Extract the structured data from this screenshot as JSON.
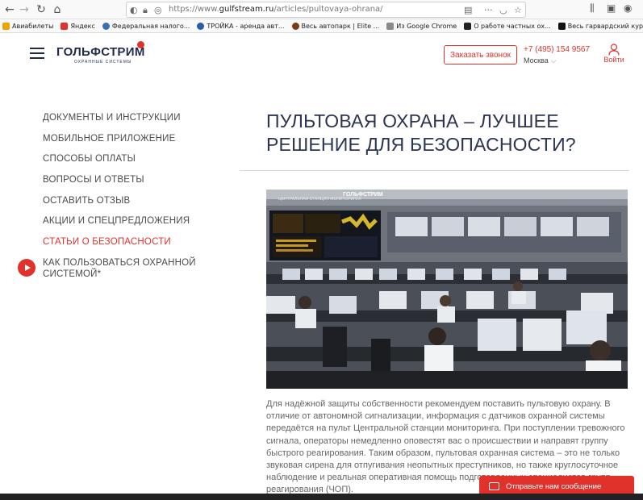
{
  "browser": {
    "url_prefix": "https://www.",
    "url_domain": "gulfstream.ru",
    "url_path": "/articles/pultovaya-ohrana/",
    "bookmarks": [
      {
        "label": "Авиабилеты",
        "color": "#f0a400"
      },
      {
        "label": "Яндекс",
        "color": "#e0322b"
      },
      {
        "label": "Федеральная налого...",
        "color": "#3a6fb0"
      },
      {
        "label": "ТРОЙКА - аренда авт...",
        "color": "#2a5ba8"
      },
      {
        "label": "Весь автопарк | Elite ...",
        "color": "#7a3b12"
      },
      {
        "label": "Из Google Chrome",
        "color": "#8a8a8a"
      },
      {
        "label": "О работе частных ох...",
        "color": "#222222"
      },
      {
        "label": "Весь гарвардский кур...",
        "color": "#111111"
      }
    ]
  },
  "header": {
    "logo_main": "ГОЛЬФСТРИМ",
    "logo_sub": "ОХРАННЫЕ СИСТЕМЫ",
    "callback_label": "Заказать звонок",
    "phone": "+7 (495) 154 9567",
    "city": "Москва",
    "login_label": "Войти"
  },
  "sidebar": {
    "items": [
      {
        "label": "ДОКУМЕНТЫ И ИНСТРУКЦИИ"
      },
      {
        "label": "МОБИЛЬНОЕ ПРИЛОЖЕНИЕ"
      },
      {
        "label": "СПОСОБЫ ОПЛАТЫ"
      },
      {
        "label": "ВОПРОСЫ И ОТВЕТЫ"
      },
      {
        "label": "ОСТАВИТЬ ОТЗЫВ"
      },
      {
        "label": "АКЦИИ И СПЕЦПРЕДЛОЖЕНИЯ"
      },
      {
        "label": "СТАТЬИ О БЕЗОПАСНОСТИ"
      },
      {
        "label": "КАК ПОЛЬЗОВАТЬСЯ ОХРАННОЙ СИСТЕМОЙ*"
      }
    ]
  },
  "article": {
    "title": "ПУЛЬТОВАЯ ОХРАНА – ЛУЧШЕЕ РЕШЕНИЕ ДЛЯ БЕЗОПАСНОСТИ?",
    "photo_sign": "ГОЛЬФСТРИМ",
    "photo_sign_sub": "ЦЕНТРАЛЬНАЯ СТАНЦИЯ МОНИТОРИНГА",
    "body": "Для надёжной защиты собственности рекомендуем поставить пультовую охрану. В отличие от автономной сигнализации, информация с датчиков охранной системы передаётся на пульт Центральной станции мониторинга. При поступлении тревожного сигнала, операторы немедленно оповестят вас о происшествии и направят группу быстрого реагирования. Таким образом, пультовая охранная система – это не только звуковая сирена для отпугивания неопытных преступников, но также круглосуточное наблюдение и реальная оперативная помощь подготовленных специалистов групп реагирования (ЧОП)."
  },
  "chat": {
    "label": "Отправьте нам сообщение"
  }
}
